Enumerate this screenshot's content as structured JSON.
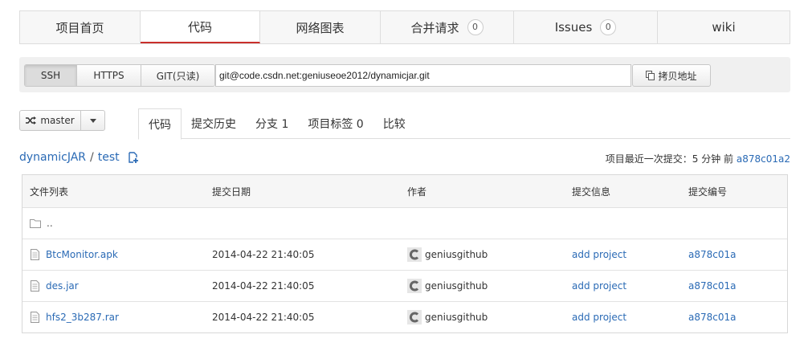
{
  "nav": {
    "tabs": [
      {
        "label": "项目首页",
        "count": null
      },
      {
        "label": "代码",
        "count": null
      },
      {
        "label": "网络图表",
        "count": null
      },
      {
        "label": "合并请求",
        "count": "0"
      },
      {
        "label": "Issues",
        "count": "0"
      },
      {
        "label": "wiki",
        "count": null
      }
    ],
    "active": "代码",
    "accent": "#c9302c"
  },
  "clone": {
    "protocols": [
      "SSH",
      "HTTPS",
      "GIT(只读)"
    ],
    "active_protocol": "SSH",
    "url": "git@code.csdn.net:geniuseoe2012/dynamicjar.git",
    "copy_label": "拷贝地址"
  },
  "branch": {
    "name": "master"
  },
  "subtabs": [
    {
      "label": "代码"
    },
    {
      "label": "提交历史"
    },
    {
      "label": "分支 1"
    },
    {
      "label": "项目标签 0"
    },
    {
      "label": "比较"
    }
  ],
  "path": {
    "repo": "dynamicJAR",
    "separator": "/",
    "folder": "test"
  },
  "last_commit": {
    "text": "项目最近一次提交：5 分钟 前",
    "hash": "a878c01a2"
  },
  "table": {
    "headers": [
      "文件列表",
      "提交日期",
      "作者",
      "提交信息",
      "提交编号"
    ],
    "parent": "..",
    "rows": [
      {
        "file": "BtcMonitor.apk",
        "date": "2014-04-22 21:40:05",
        "author": "geniusgithub",
        "message": "add project",
        "hash": "a878c01a"
      },
      {
        "file": "des.jar",
        "date": "2014-04-22 21:40:05",
        "author": "geniusgithub",
        "message": "add project",
        "hash": "a878c01a"
      },
      {
        "file": "hfs2_3b287.rar",
        "date": "2014-04-22 21:40:05",
        "author": "geniusgithub",
        "message": "add project",
        "hash": "a878c01a"
      }
    ],
    "link_color": "#2a6ab5"
  }
}
